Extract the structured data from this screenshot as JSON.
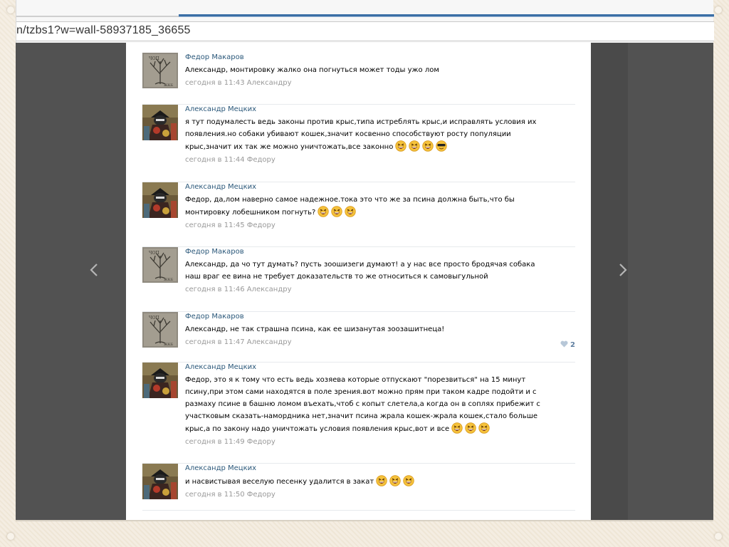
{
  "browser": {
    "url": "n/tzbs1?w=wall-58937185_36655"
  },
  "viewer": {
    "prev_icon": "chevron-left-icon",
    "next_icon": "chevron-right-icon"
  },
  "colors": {
    "link": "#2b587a",
    "meta": "#999999",
    "viewer_bg": "#4a4a4a",
    "like": "#5f7fa0"
  },
  "comments": [
    {
      "author": "Федор Макаров",
      "avatar": "tree-avatar",
      "text": "Александр, монтировку жалко она погнуться может тоды ужо лом",
      "emojis": [],
      "time": "сегодня в 11:43",
      "reply_to": "Александру",
      "likes": ""
    },
    {
      "author": "Александр Мецких",
      "avatar": "warrior-avatar",
      "text_lines": [
        "я тут подумалесть ведь законы против крыс,типа истреблять крыс,и исправлять условия их",
        "появления.но собаки убивают кошек,значит косвенно способствуют росту популяции",
        "крыс,значит их так же можно уничтожать,все законно"
      ],
      "emojis": [
        "laughing-emoji",
        "laughing-emoji",
        "laughing-emoji",
        "sunglasses-emoji"
      ],
      "time": "сегодня в 11:44",
      "reply_to": "Федору",
      "likes": ""
    },
    {
      "author": "Александр Мецких",
      "avatar": "warrior-avatar",
      "text_lines": [
        "Федор, да,лом наверно самое надежное.тока это что же за псина должна быть,что бы",
        "монтировку лобешником погнуть?"
      ],
      "emojis": [
        "laughing-emoji",
        "laughing-emoji",
        "laughing-emoji"
      ],
      "time": "сегодня в 11:45",
      "reply_to": "Федору",
      "likes": ""
    },
    {
      "author": "Федор Макаров",
      "avatar": "tree-avatar",
      "text_lines": [
        "Александр, да чо тут думать? пусть зоошизеги думают! а у нас все просто бродячая собака",
        "наш враг ее вина не требует доказательств то же относиться к самовыгульной"
      ],
      "emojis": [],
      "time": "сегодня в 11:46",
      "reply_to": "Александру",
      "likes": ""
    },
    {
      "author": "Федор Макаров",
      "avatar": "tree-avatar",
      "text": "Александр, не так страшна псина, как ее шизанутая зоозашитнеца!",
      "emojis": [],
      "time": "сегодня в 11:47",
      "reply_to": "Александру",
      "likes": "2"
    },
    {
      "author": "Александр Мецких",
      "avatar": "warrior-avatar",
      "text_lines": [
        "Федор, это я к тому что есть ведь хозяева которые отпускают \"порезвиться\" на 15 минут",
        "псину,при этом сами находятся в поле зрения.вот можно прям при таком кадре подойти и с",
        "размаху псине в башню ломом въехать,чтоб с копыт слетела,а когда он в соплях прибежит с",
        "участковым сказать-намордника нет,значит псина жрала кошек-жрала кошек,стало больше",
        "крыс,а по закону надо уничтожать условия появления крыс,вот и все"
      ],
      "emojis": [
        "laughing-emoji",
        "laughing-emoji",
        "laughing-emoji"
      ],
      "time": "сегодня в 11:49",
      "reply_to": "Федору",
      "likes": ""
    },
    {
      "author": "Александр Мецких",
      "avatar": "warrior-avatar",
      "text": "и насвистывая веселую песенку удалится в закат",
      "emojis": [
        "laughing-emoji",
        "laughing-emoji",
        "laughing-emoji"
      ],
      "time": "сегодня в 11:50",
      "reply_to": "Федору",
      "likes": ""
    }
  ]
}
